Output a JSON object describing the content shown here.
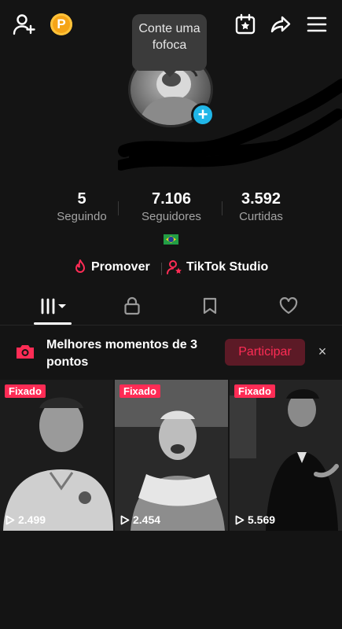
{
  "tooltip": "Conte uma fofoca",
  "coin_label": "P",
  "stats": [
    {
      "value": "5",
      "label": "Seguindo"
    },
    {
      "value": "7.106",
      "label": "Seguidores"
    },
    {
      "value": "3.592",
      "label": "Curtidas"
    }
  ],
  "actions": {
    "promote": "Promover",
    "studio": "TikTok Studio"
  },
  "banner": {
    "title": "Melhores momentos de 3 pontos",
    "join_label": "Participar",
    "close": "×"
  },
  "videos": [
    {
      "pinned_label": "Fixado",
      "views": "2.499"
    },
    {
      "pinned_label": "Fixado",
      "views": "2.454"
    },
    {
      "pinned_label": "Fixado",
      "views": "5.569"
    }
  ],
  "colors": {
    "accent": "#fe2c55",
    "background": "#141414",
    "avatar_add": "#20b6e8",
    "coin": "#f5a417"
  }
}
